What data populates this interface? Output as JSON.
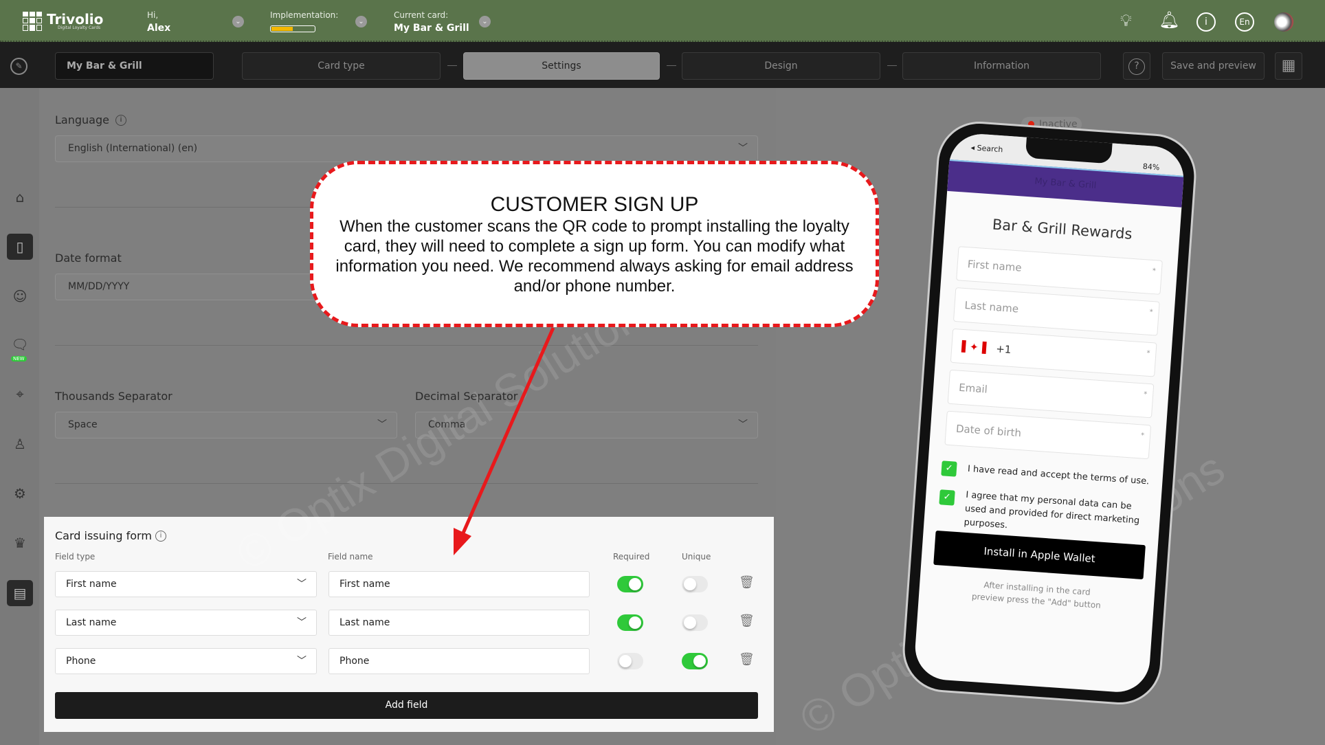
{
  "header": {
    "logo_text": "Trivolio",
    "logo_tagline": "Digital Loyalty Cards",
    "greeting": "Hi,",
    "user_name": "Alex",
    "implementation_label": "Implementation:",
    "implementation_progress": 0.5,
    "current_card_label": "Current card:",
    "current_card": "My Bar & Grill",
    "icons": [
      "lightbulb-icon",
      "bell-icon",
      "info-icon",
      "language-icon",
      "avatar"
    ],
    "language": "En"
  },
  "toolbar": {
    "card_name": "My Bar & Grill",
    "steps": [
      "Card type",
      "Settings",
      "Design",
      "Information"
    ],
    "active_step": "Settings",
    "help": "?",
    "save_preview": "Save and preview"
  },
  "sidebar": {
    "items": [
      "home",
      "card",
      "customers",
      "messages",
      "locations",
      "user",
      "settings",
      "crown",
      "store"
    ],
    "new_badge": "NEW"
  },
  "settings": {
    "language_label": "Language",
    "language_value": "English (International) (en)",
    "date_format_label": "Date format",
    "date_format_value": "MM/DD/YYYY",
    "thousands_label": "Thousands Separator",
    "thousands_value": "Space",
    "decimal_label": "Decimal Separator",
    "decimal_value": "Comma"
  },
  "card_form": {
    "title": "Card issuing form",
    "col_field_type": "Field type",
    "col_field_name": "Field name",
    "col_required": "Required",
    "col_unique": "Unique",
    "rows": [
      {
        "type": "First name",
        "name": "First name",
        "required": true,
        "unique": false
      },
      {
        "type": "Last name",
        "name": "Last name",
        "required": true,
        "unique": false
      },
      {
        "type": "Phone",
        "name": "Phone",
        "required": false,
        "unique": true
      }
    ],
    "add_field": "Add field"
  },
  "callout": {
    "title": "CUSTOMER SIGN UP",
    "body": "When the customer scans the QR code to prompt installing the loyalty card, they will need to complete a sign up form.  You can modify what information you need.  We recommend always asking for email address and/or phone number.",
    "border_color": "#e8191c"
  },
  "watermark": "© Optix Digital Solutions",
  "preview": {
    "status": "Inactive",
    "status_bar_left": "◂ Search",
    "battery": "84%",
    "header_text": "My Bar & Grill",
    "header_color": "#4b2e8a",
    "title": "Bar & Grill Rewards",
    "fields": [
      "First name",
      "Last name",
      "Email",
      "Date of birth"
    ],
    "phone_code": "+1",
    "terms": "I have read and accept the terms of use.",
    "marketing": "I agree that my personal data can be used and provided for direct marketing purposes.",
    "install_button": "Install in Apple Wallet",
    "footnote": "After installing in the card preview press the \"Add\" button"
  },
  "colors": {
    "header": "#5a744b",
    "toggle_on": "#2fc93a",
    "progress": "#f5b800"
  }
}
